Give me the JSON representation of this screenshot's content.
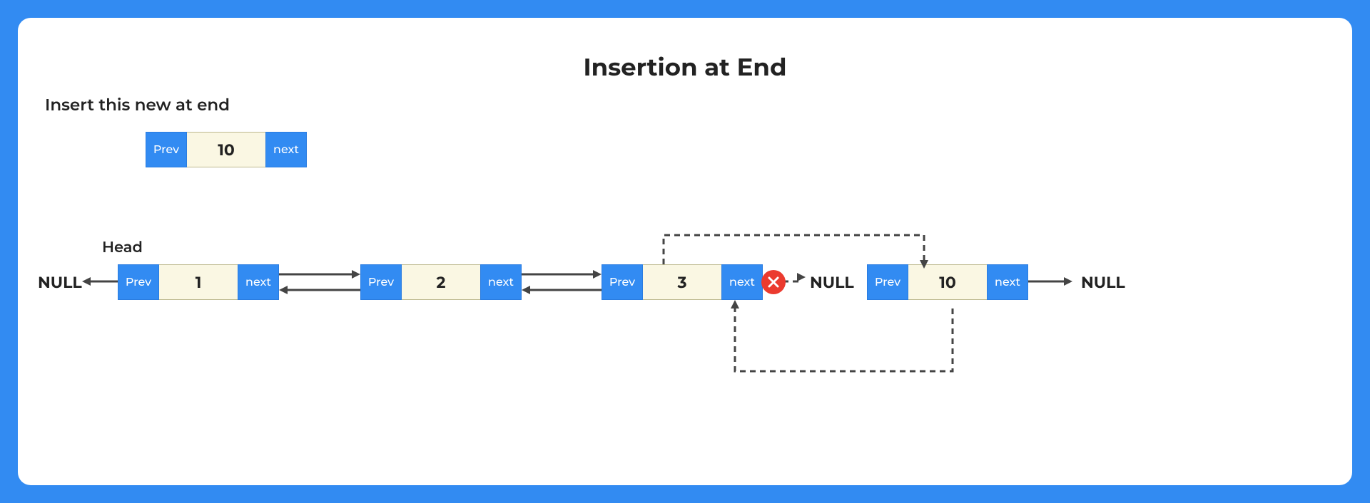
{
  "title": "Insertion at End",
  "caption": "Insert this new at end",
  "head_label": "Head",
  "null_text": "NULL",
  "ptr_prev": "Prev",
  "ptr_next": "next",
  "new_node_value": "10",
  "nodes": [
    "1",
    "2",
    "3",
    "10"
  ]
}
